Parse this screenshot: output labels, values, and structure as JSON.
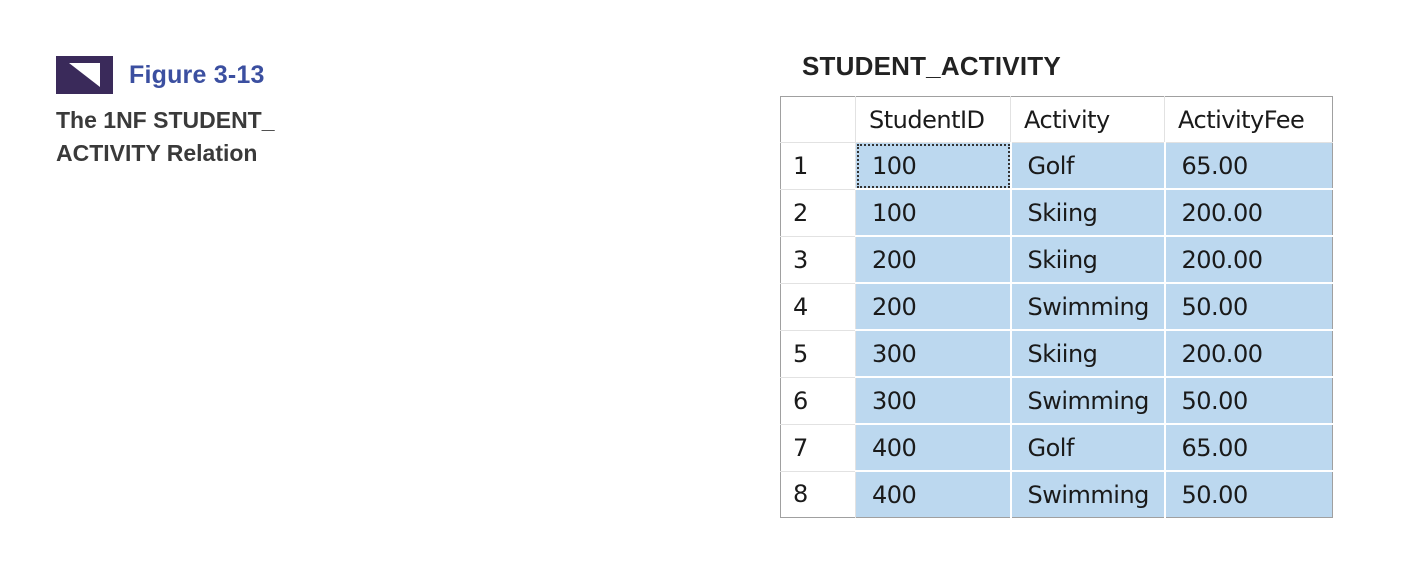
{
  "figure": {
    "icon": "figure-marker-icon",
    "label": "Figure 3-13",
    "description_line1": "The 1NF STUDENT_",
    "description_line2": "ACTIVITY Relation"
  },
  "table": {
    "title": "STUDENT_ACTIVITY",
    "columns": [
      "StudentID",
      "Activity",
      "ActivityFee"
    ],
    "rows": [
      {
        "n": "1",
        "id": "100",
        "activity": "Golf",
        "fee": "65.00"
      },
      {
        "n": "2",
        "id": "100",
        "activity": "Skiing",
        "fee": "200.00"
      },
      {
        "n": "3",
        "id": "200",
        "activity": "Skiing",
        "fee": "200.00"
      },
      {
        "n": "4",
        "id": "200",
        "activity": "Swimming",
        "fee": "50.00"
      },
      {
        "n": "5",
        "id": "300",
        "activity": "Skiing",
        "fee": "200.00"
      },
      {
        "n": "6",
        "id": "300",
        "activity": "Swimming",
        "fee": "50.00"
      },
      {
        "n": "7",
        "id": "400",
        "activity": "Golf",
        "fee": "65.00"
      },
      {
        "n": "8",
        "id": "400",
        "activity": "Swimming",
        "fee": "50.00"
      }
    ]
  },
  "colors": {
    "selection": "#bcd8ef",
    "figure_label": "#3b4fa0",
    "icon_dark": "#3a2a5a"
  }
}
